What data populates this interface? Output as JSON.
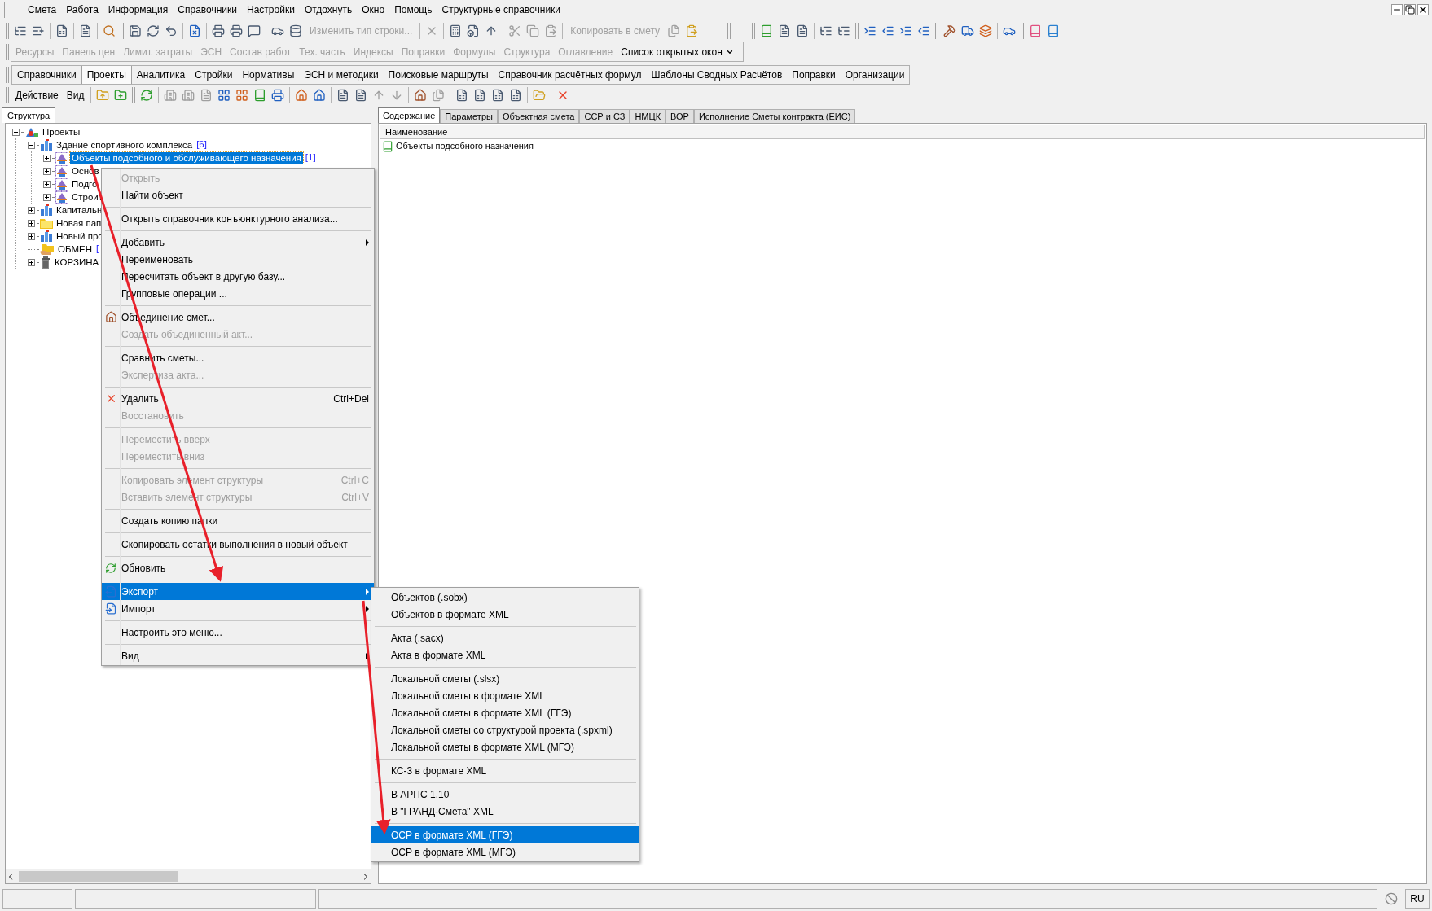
{
  "menu_bar": [
    "Смета",
    "Работа",
    "Информация",
    "Справочники",
    "Настройки",
    "Отдохнуть",
    "Окно",
    "Помощь",
    "Структурные справочники"
  ],
  "toolbar": {
    "change_row_type": {
      "label": "Изменить тип строки...",
      "disabled": true
    },
    "copy_to_estimate": {
      "label": "Копировать в смету",
      "disabled": true
    }
  },
  "panels_bar": [
    {
      "label": "Ресурсы",
      "disabled": true
    },
    {
      "label": "Панель цен",
      "disabled": true
    },
    {
      "label": "Лимит. затраты",
      "disabled": true
    },
    {
      "label": "ЭСН",
      "disabled": true
    },
    {
      "label": "Состав работ",
      "disabled": true
    },
    {
      "label": "Тех. часть",
      "disabled": true
    },
    {
      "label": "Индексы",
      "disabled": true
    },
    {
      "label": "Поправки",
      "disabled": true
    },
    {
      "label": "Формулы",
      "disabled": true
    },
    {
      "label": "Структура",
      "disabled": true
    },
    {
      "label": "Оглавление",
      "disabled": true
    }
  ],
  "open_windows": {
    "label": "Список открытых окон"
  },
  "tabs": [
    {
      "label": "Справочники",
      "selected": false
    },
    {
      "label": "Проекты",
      "selected": true
    },
    {
      "label": "Аналитика",
      "selected": false
    },
    {
      "label": "Стройки",
      "selected": false
    },
    {
      "label": "Нормативы",
      "selected": false
    },
    {
      "label": "ЭСН и методики",
      "selected": false
    },
    {
      "label": "Поисковые маршруты",
      "selected": false
    },
    {
      "label": "Справочник расчётных формул",
      "selected": false
    },
    {
      "label": "Шаблоны Сводных Расчётов",
      "selected": false
    },
    {
      "label": "Поправки",
      "selected": false
    },
    {
      "label": "Организации",
      "selected": false
    }
  ],
  "action_bar": [
    "Действие",
    "Вид"
  ],
  "left_tabs": [
    {
      "label": "Структура",
      "selected": true
    }
  ],
  "tree": [
    {
      "label": "Проекты",
      "kind": "root",
      "has_children": true,
      "expanded": true,
      "selected": false,
      "children": [
        {
          "label": "Здание спортивного комплекса",
          "count": "[6]",
          "kind": "building",
          "has_children": true,
          "expanded": true,
          "selected": false,
          "children": [
            {
              "label": "Объекты подсобного и обслуживающего назначения",
              "count": "[1]",
              "kind": "object",
              "has_children": true,
              "expanded": false,
              "selected": true
            },
            {
              "label": "Основ",
              "kind": "object",
              "has_children": true,
              "expanded": false,
              "selected": false
            },
            {
              "label": "Подго",
              "kind": "object",
              "has_children": true,
              "expanded": false,
              "selected": false
            },
            {
              "label": "Строит",
              "kind": "object",
              "has_children": true,
              "expanded": false,
              "selected": false
            }
          ]
        },
        {
          "label": "Капитальн",
          "kind": "building",
          "has_children": true,
          "expanded": false,
          "selected": false
        },
        {
          "label": "Новая пап",
          "kind": "folder",
          "has_children": true,
          "expanded": false,
          "selected": false
        },
        {
          "label": "Новый про",
          "kind": "building",
          "has_children": true,
          "expanded": false,
          "selected": false
        },
        {
          "label": "ОБМЕН",
          "count": "[",
          "kind": "exchange",
          "has_children": false,
          "selected": false
        },
        {
          "label": "КОРЗИНА",
          "kind": "trash",
          "has_children": true,
          "expanded": false,
          "selected": false
        }
      ]
    }
  ],
  "context_menu": [
    {
      "kind": "item",
      "label": "Открыть",
      "disabled": true,
      "selected": false
    },
    {
      "kind": "item",
      "label": "Найти объект",
      "disabled": false,
      "selected": false
    },
    {
      "kind": "separator"
    },
    {
      "kind": "item",
      "label": "Открыть справочник конъюнктурного анализа...",
      "disabled": false,
      "selected": false
    },
    {
      "kind": "separator"
    },
    {
      "kind": "item",
      "label": "Добавить",
      "disabled": false,
      "selected": false,
      "submenu": true
    },
    {
      "kind": "item",
      "label": "Переименовать",
      "disabled": false,
      "selected": false
    },
    {
      "kind": "item",
      "label": "Пересчитать объект в другую базу...",
      "disabled": false,
      "selected": false
    },
    {
      "kind": "item",
      "label": "Групповые операции ...",
      "disabled": false,
      "selected": false
    },
    {
      "kind": "separator"
    },
    {
      "kind": "item",
      "label": "Объединение смет...",
      "disabled": false,
      "selected": false
    },
    {
      "kind": "item",
      "label": "Создать объединенный акт...",
      "disabled": true,
      "selected": false
    },
    {
      "kind": "separator"
    },
    {
      "kind": "item",
      "label": "Сравнить сметы...",
      "disabled": false,
      "selected": false
    },
    {
      "kind": "item",
      "label": "Экспертиза акта...",
      "disabled": true,
      "selected": false
    },
    {
      "kind": "separator"
    },
    {
      "kind": "item",
      "label": "Удалить",
      "shortcut": "Ctrl+Del",
      "disabled": false,
      "selected": false
    },
    {
      "kind": "item",
      "label": "Восстановить",
      "disabled": true,
      "selected": false
    },
    {
      "kind": "separator"
    },
    {
      "kind": "item",
      "label": "Переместить вверх",
      "disabled": true,
      "selected": false
    },
    {
      "kind": "item",
      "label": "Переместить вниз",
      "disabled": true,
      "selected": false
    },
    {
      "kind": "separator"
    },
    {
      "kind": "item",
      "label": "Копировать элемент структуры",
      "shortcut": "Ctrl+C",
      "disabled": true,
      "selected": false
    },
    {
      "kind": "item",
      "label": "Вставить элемент структуры",
      "shortcut": "Ctrl+V",
      "disabled": true,
      "selected": false
    },
    {
      "kind": "separator"
    },
    {
      "kind": "item",
      "label": "Создать копию папки",
      "disabled": false,
      "selected": false
    },
    {
      "kind": "separator"
    },
    {
      "kind": "item",
      "label": "Скопировать остатки выполнения в новый объект",
      "disabled": false,
      "selected": false
    },
    {
      "kind": "separator"
    },
    {
      "kind": "item",
      "label": "Обновить",
      "disabled": false,
      "selected": false
    },
    {
      "kind": "separator"
    },
    {
      "kind": "item",
      "label": "Экспорт",
      "disabled": false,
      "selected": true,
      "submenu": true
    },
    {
      "kind": "item",
      "label": "Импорт",
      "disabled": false,
      "selected": false,
      "submenu": true
    },
    {
      "kind": "separator"
    },
    {
      "kind": "item",
      "label": "Настроить это меню...",
      "disabled": false,
      "selected": false
    },
    {
      "kind": "separator"
    },
    {
      "kind": "item",
      "label": "Вид",
      "disabled": false,
      "selected": false,
      "submenu": true
    }
  ],
  "export_submenu": [
    {
      "kind": "item",
      "label": "Объектов (.sobx)",
      "selected": false
    },
    {
      "kind": "item",
      "label": "Объектов в формате XML",
      "selected": false
    },
    {
      "kind": "separator"
    },
    {
      "kind": "item",
      "label": "Акта (.sacx)",
      "selected": false
    },
    {
      "kind": "item",
      "label": "Акта в формате XML",
      "selected": false
    },
    {
      "kind": "separator"
    },
    {
      "kind": "item",
      "label": "Локальной сметы (.slsx)",
      "selected": false
    },
    {
      "kind": "item",
      "label": "Локальной сметы в формате XML",
      "selected": false
    },
    {
      "kind": "item",
      "label": "Локальной сметы в формате XML (ГГЭ)",
      "selected": false
    },
    {
      "kind": "item",
      "label": "Локальной сметы со структурой проекта (.spxml)",
      "selected": false
    },
    {
      "kind": "item",
      "label": "Локальной сметы в формате XML (МГЭ)",
      "selected": false
    },
    {
      "kind": "separator"
    },
    {
      "kind": "item",
      "label": "КС-3 в формате XML",
      "selected": false
    },
    {
      "kind": "separator"
    },
    {
      "kind": "item",
      "label": "В АРПС 1.10",
      "selected": false
    },
    {
      "kind": "item",
      "label": "В \"ГРАНД-Смета\" XML",
      "selected": false
    },
    {
      "kind": "separator"
    },
    {
      "kind": "item",
      "label": "ОСР в формате XML (ГГЭ)",
      "selected": true
    },
    {
      "kind": "item",
      "label": "ОСР в формате XML (МГЭ)",
      "selected": false
    }
  ],
  "right_tabs": [
    {
      "label": "Содержание",
      "selected": true
    },
    {
      "label": "Параметры",
      "selected": false
    },
    {
      "label": "Объектная смета",
      "selected": false
    },
    {
      "label": "ССР и СЗ",
      "selected": false
    },
    {
      "label": "НМЦК",
      "selected": false
    },
    {
      "label": "ВОР",
      "selected": false
    },
    {
      "label": "Исполнение Сметы контракта (ЕИС)",
      "selected": false
    }
  ],
  "content": {
    "columns": [
      "Наименование"
    ],
    "rows": [
      "Объекты подсобного назначения"
    ]
  },
  "status_bar": {
    "language": "RU"
  }
}
